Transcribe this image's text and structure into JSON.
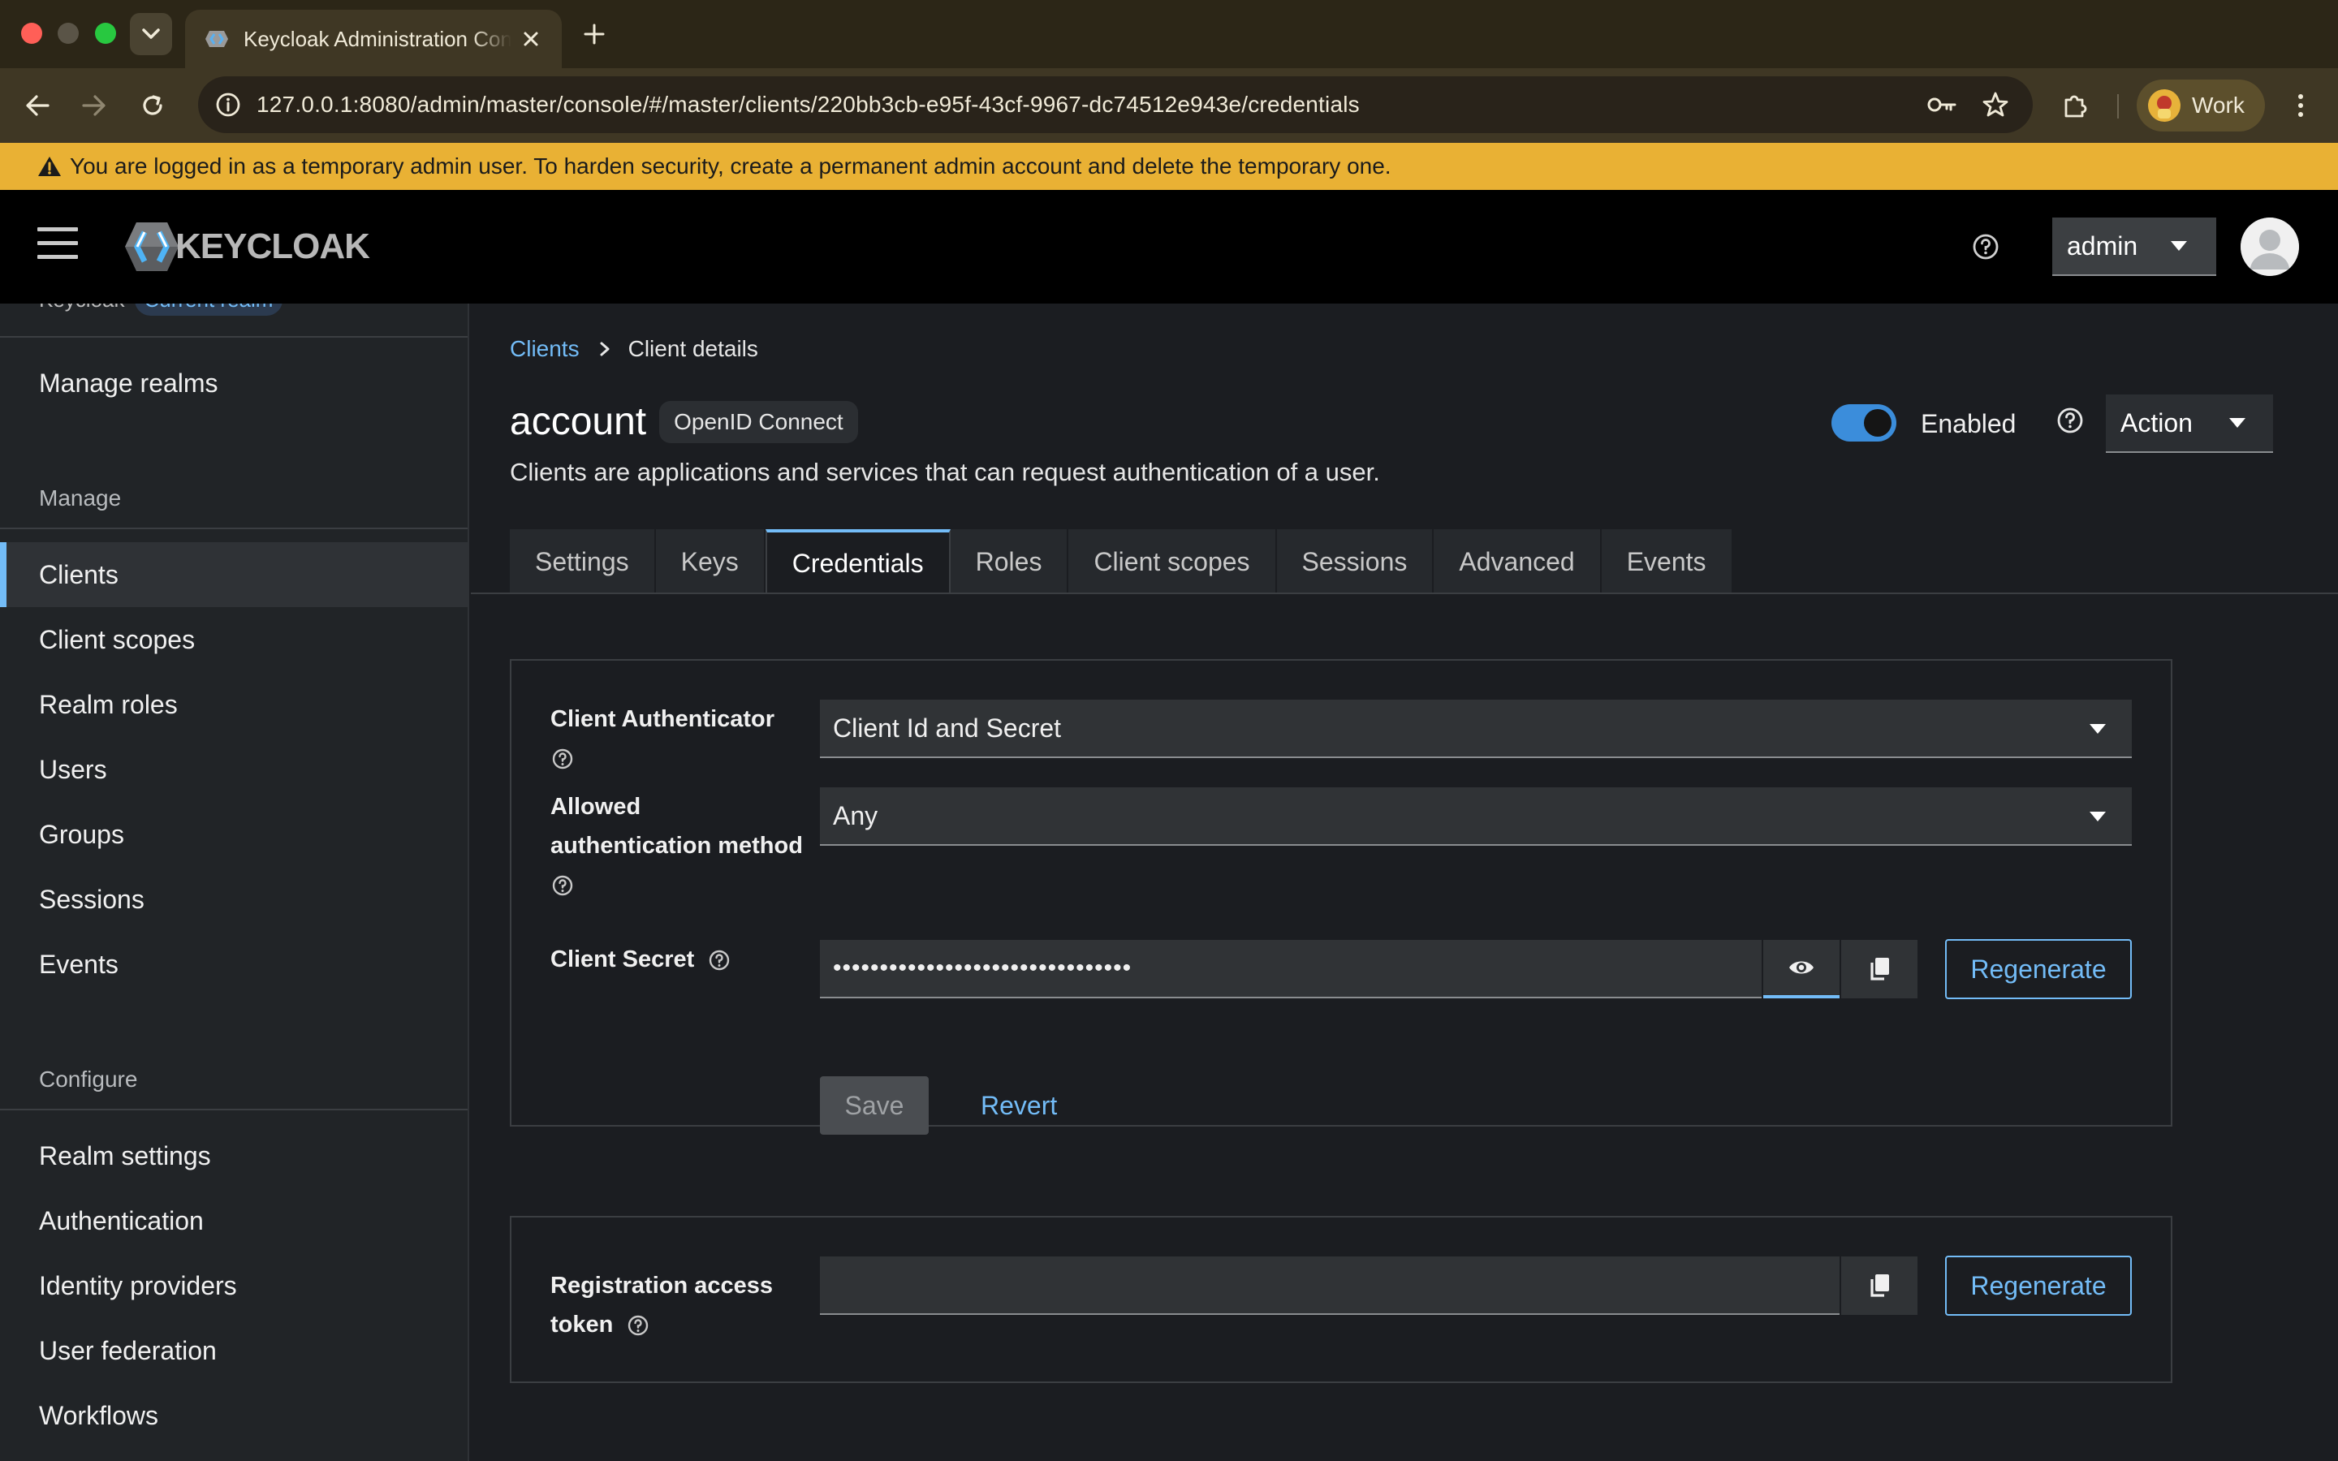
{
  "browser": {
    "tab_title": "Keycloak Administration Console",
    "url": "127.0.0.1:8080/admin/master/console/#/master/clients/220bb3cb-e95f-43cf-9967-dc74512e943e/credentials",
    "profile_label": "Work"
  },
  "banner": {
    "text": "You are logged in as a temporary admin user. To harden security, create a permanent admin account and delete the temporary one."
  },
  "header": {
    "logo_text": "KEYCLOAK",
    "user_menu_label": "admin"
  },
  "sidebar": {
    "realm_name": "Keycloak",
    "realm_badge": "Current realm",
    "manage_realms": "Manage realms",
    "sections": {
      "manage": "Manage",
      "configure": "Configure"
    },
    "manage_items": [
      {
        "label": "Clients",
        "active": true
      },
      {
        "label": "Client scopes"
      },
      {
        "label": "Realm roles"
      },
      {
        "label": "Users"
      },
      {
        "label": "Groups"
      },
      {
        "label": "Sessions"
      },
      {
        "label": "Events"
      }
    ],
    "configure_items": [
      {
        "label": "Realm settings"
      },
      {
        "label": "Authentication"
      },
      {
        "label": "Identity providers"
      },
      {
        "label": "User federation"
      },
      {
        "label": "Workflows"
      }
    ]
  },
  "main": {
    "breadcrumb": {
      "parent": "Clients",
      "current": "Client details"
    },
    "title": "account",
    "protocol_label": "OpenID Connect",
    "subtitle": "Clients are applications and services that can request authentication of a user.",
    "enabled_label": "Enabled",
    "enabled": true,
    "action_label": "Action",
    "tabs": [
      {
        "label": "Settings"
      },
      {
        "label": "Keys"
      },
      {
        "label": "Credentials",
        "active": true
      },
      {
        "label": "Roles"
      },
      {
        "label": "Client scopes"
      },
      {
        "label": "Sessions"
      },
      {
        "label": "Advanced"
      },
      {
        "label": "Events"
      }
    ],
    "credentials": {
      "client_authenticator_label": "Client Authenticator",
      "client_authenticator_value": "Client Id and Secret",
      "allowed_method_label_1": "Allowed",
      "allowed_method_label_2": "authentication method",
      "allowed_method_value": "Any",
      "client_secret_label": "Client Secret",
      "client_secret_value": "••••••••••••••••••••••••••••••••",
      "regenerate_label": "Regenerate",
      "save_label": "Save",
      "revert_label": "Revert"
    },
    "registration": {
      "label_1": "Registration access",
      "label_2": "token",
      "value": "",
      "regenerate_label": "Regenerate"
    }
  },
  "colors": {
    "accent": "#73bcf7",
    "banner": "#e9b134",
    "toggle_on": "#3b8ddb"
  }
}
